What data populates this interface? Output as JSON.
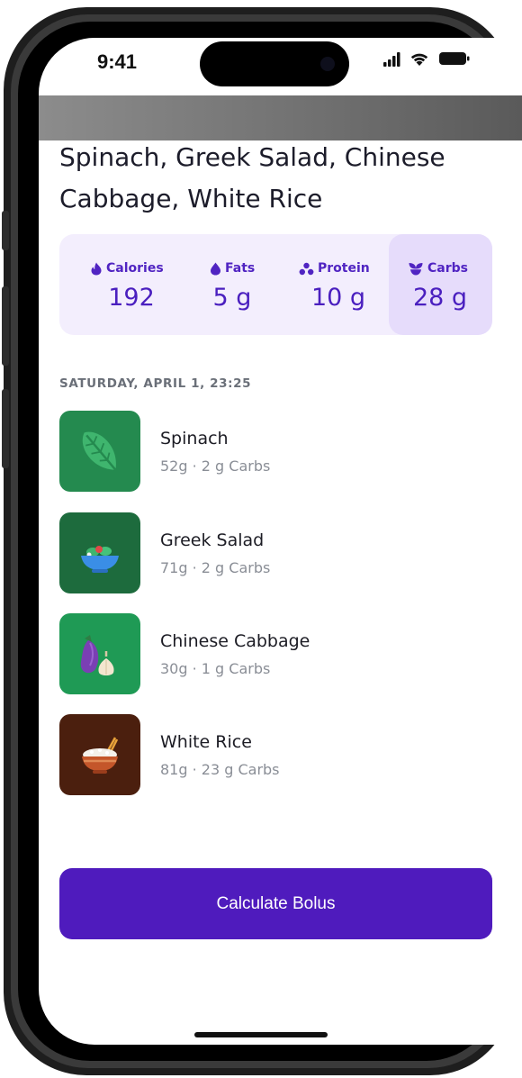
{
  "status_bar": {
    "time": "9:41"
  },
  "meal": {
    "title": "Spinach, Greek Salad, Chinese Cabbage, White Rice"
  },
  "macros": [
    {
      "label": "Calories",
      "value": "192",
      "icon": "flame-icon"
    },
    {
      "label": "Fats",
      "value": "5 g",
      "icon": "drop-icon"
    },
    {
      "label": "Protein",
      "value": "10 g",
      "icon": "dots-icon"
    },
    {
      "label": "Carbs",
      "value": "28 g",
      "icon": "sprout-icon",
      "selected": true
    }
  ],
  "log": {
    "date": "SATURDAY, APRIL 1, 23:25",
    "items": [
      {
        "name": "Spinach",
        "detail": "52g · 2 g Carbs",
        "icon": "spinach-leaf-icon",
        "color": "#248a4f"
      },
      {
        "name": "Greek Salad",
        "detail": "71g · 2 g Carbs",
        "icon": "salad-bowl-icon",
        "color": "#1d6b3d"
      },
      {
        "name": "Chinese Cabbage",
        "detail": "30g · 1 g Carbs",
        "icon": "eggplant-garlic-icon",
        "color": "#1f9a55"
      },
      {
        "name": "White Rice",
        "detail": "81g · 23 g Carbs",
        "icon": "rice-bowl-icon",
        "color": "#4b1f0e"
      }
    ]
  },
  "actions": {
    "calculate_label": "Calculate Bolus"
  },
  "colors": {
    "accent": "#4f1bbd",
    "macro_card": "#f3eefd",
    "macro_selected": "#e6dcfb"
  }
}
